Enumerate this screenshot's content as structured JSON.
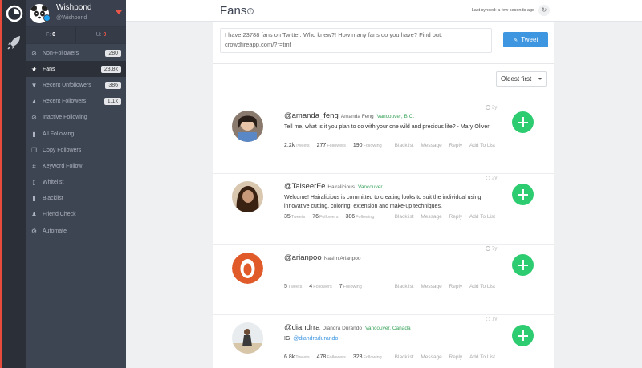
{
  "account": {
    "name": "Wishpond",
    "handle": "@Wishpond"
  },
  "counts": {
    "f_label": "F:",
    "f_value": "0",
    "u_label": "U:",
    "u_value": "0"
  },
  "nav": [
    {
      "label": "Non-Followers",
      "count": "280",
      "icon": "ban-icon"
    },
    {
      "label": "Fans",
      "count": "23.8k",
      "icon": "star-icon"
    },
    {
      "label": "Recent Unfollowers",
      "count": "386",
      "icon": "thumbs-down-icon"
    },
    {
      "label": "Recent Followers",
      "count": "1.1k",
      "icon": "thumbs-up-icon"
    },
    {
      "label": "Inactive Following",
      "count": "",
      "icon": "no-entry-icon"
    },
    {
      "label": "All Following",
      "count": "",
      "icon": "file-icon"
    },
    {
      "label": "Copy Followers",
      "count": "",
      "icon": "copy-icon"
    },
    {
      "label": "Keyword Follow",
      "count": "",
      "icon": "hashtag-icon"
    },
    {
      "label": "Whitelist",
      "count": "",
      "icon": "whitelist-icon"
    },
    {
      "label": "Blacklist",
      "count": "",
      "icon": "blacklist-icon"
    },
    {
      "label": "Friend Check",
      "count": "",
      "icon": "people-icon"
    },
    {
      "label": "Automate",
      "count": "",
      "icon": "gears-icon"
    }
  ],
  "header": {
    "title": "Fans",
    "sync_text": "Last synced: a few seconds ago"
  },
  "tweet": {
    "text": "I have 23788 fans on Twitter. Who knew?! How many fans do you have? Find out: crowdfireapp.com/?r=tmf",
    "button_label": "Tweet"
  },
  "sort": {
    "selected": "Oldest first"
  },
  "users": [
    {
      "handle": "@amanda_feng",
      "name": "Amanda Feng",
      "location": "Vancouver, B.C.",
      "bio": "Tell me, what is it you plan to do with your one wild and precious life? - Mary Oliver",
      "tweets": "2.2k",
      "followers": "277",
      "following": "190",
      "time": "2y"
    },
    {
      "handle": "@TaiseerFe",
      "name": "Hairalicious",
      "location": "Vancouver",
      "bio": "Welcome! Hairalicious is committed to creating looks to suit the individual using innovative cutting, coloring, extension and make-up techniques.",
      "tweets": "35",
      "followers": "76",
      "following": "386",
      "time": "2y"
    },
    {
      "handle": "@arianpoo",
      "name": "Nasim Arianpoo",
      "location": "",
      "bio": "",
      "tweets": "5",
      "followers": "4",
      "following": "7",
      "time": "3y"
    },
    {
      "handle": "@diandrra",
      "name": "Diandra Durando",
      "location": "Vancouver, Canada",
      "bio_prefix": "IG: ",
      "bio_link": "@diandradurando",
      "tweets": "6.8k",
      "followers": "478",
      "following": "323",
      "time": "1y"
    }
  ],
  "labels": {
    "tweets": "Tweets",
    "followers": "Followers",
    "following": "Following"
  },
  "actions": {
    "blacklist": "Blacklist",
    "message": "Message",
    "reply": "Reply",
    "add_to_list": "Add To List"
  },
  "colors": {
    "accent": "#2ecc71",
    "brand_red": "#e64b3c",
    "tweet_blue": "#3f96e0",
    "sidebar_bg": "#3d4452"
  }
}
